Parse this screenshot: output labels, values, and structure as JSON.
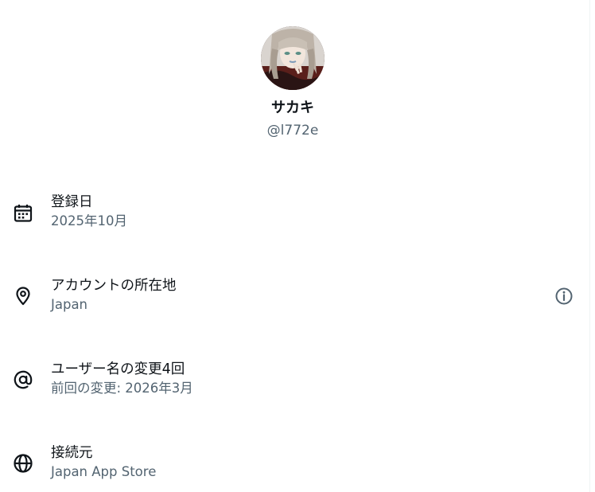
{
  "profile": {
    "display_name": "サカキ",
    "handle": "@l772e",
    "avatar_icon": "user-avatar-image"
  },
  "rows": [
    {
      "icon": "calendar-icon",
      "title": "登録日",
      "value": "2025年10月"
    },
    {
      "icon": "location-pin-icon",
      "title": "アカウントの所在地",
      "value": "Japan",
      "action_icon": "info-icon"
    },
    {
      "icon": "at-sign-icon",
      "title": "ユーザー名の変更4回",
      "value": "前回の変更: 2026年3月"
    },
    {
      "icon": "globe-icon",
      "title": "接続元",
      "value": "Japan App Store"
    }
  ],
  "colors": {
    "primary_text": "#0f1419",
    "secondary_text": "#536471",
    "background": "#ffffff"
  }
}
